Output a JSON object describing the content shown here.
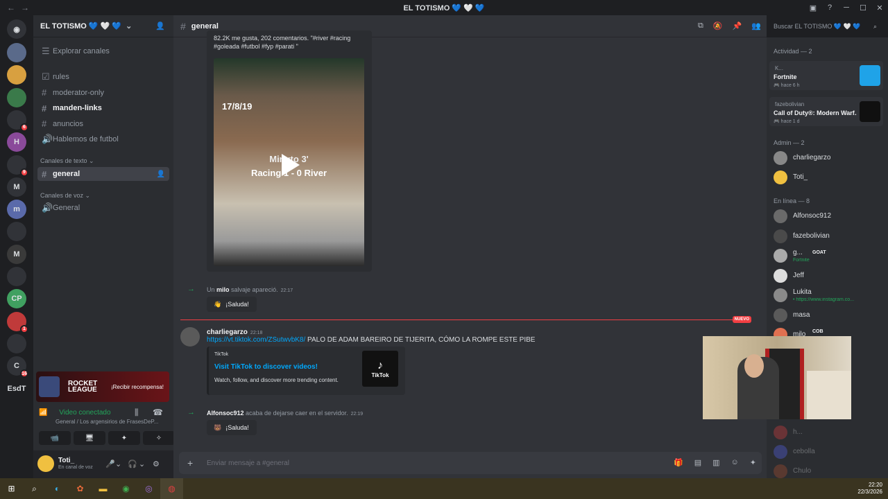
{
  "window": {
    "title": "EL TOTISMO 💙 🤍 💙",
    "nav_back": "←",
    "nav_fwd": "→"
  },
  "servers": {
    "items": [
      {
        "label": "",
        "badge": ""
      },
      {
        "label": "",
        "badge": ""
      },
      {
        "label": "",
        "badge": ""
      },
      {
        "label": "",
        "badge": "6"
      },
      {
        "label": "H",
        "badge": ""
      },
      {
        "label": "",
        "badge": "9"
      },
      {
        "label": "M",
        "badge": ""
      },
      {
        "label": "m",
        "badge": ""
      },
      {
        "label": "",
        "badge": ""
      },
      {
        "label": "M",
        "badge": ""
      },
      {
        "label": "",
        "badge": ""
      },
      {
        "label": "CP",
        "badge": ""
      },
      {
        "label": "",
        "badge": "1"
      },
      {
        "label": "",
        "badge": ""
      },
      {
        "label": "C",
        "badge": "16"
      },
      {
        "label": "EsdT",
        "badge": ""
      }
    ]
  },
  "sidebar": {
    "guild_name": "EL TOTISMO 💙 🤍 💙",
    "browse": "Explorar canales",
    "channels": [
      {
        "name": "rules",
        "state": "normal"
      },
      {
        "name": "moderator-only",
        "state": "normal"
      },
      {
        "name": "manden-links",
        "state": "unread"
      },
      {
        "name": "anuncios",
        "state": "normal"
      },
      {
        "name": "Hablemos de futbol",
        "state": "normal"
      }
    ],
    "text_category": "Canales de texto",
    "active_channel": "general",
    "voice_category": "Canales de voz",
    "voice_channel": "General"
  },
  "promo": {
    "brand": "ROCKET LEAGUE",
    "cta": "¡Recibir recompensa!"
  },
  "voice": {
    "status": "Video conectado",
    "sub": "General / Los argensirios de FrasesDeP...",
    "buttons": [
      "📹",
      "🖥",
      "✦",
      "✧"
    ]
  },
  "user": {
    "name": "Toti_",
    "status": "En canal de voz"
  },
  "chat": {
    "channel": "general",
    "embed_top_text_1": "82.2K me gusta, 202 comentarios. \"#river #racing",
    "embed_top_text_2": "#goleada #futbol #fyp #parati \"",
    "video_overlay_date": "17/8/19",
    "video_overlay_1": "Minuto 3'",
    "video_overlay_2": "Racing 1 - 0 River",
    "sys1": {
      "pre": "Un ",
      "user": "milo",
      "post": " salvaje apareció.",
      "time": "22:17"
    },
    "wave": "¡Saluda!",
    "new_label": "NUEVO",
    "msg": {
      "author": "charliegarzo",
      "time": "22:18",
      "link": "https://vt.tiktok.com/ZSutwvbK8/",
      "text": " PALO DE ADAM BAREIRO DE TIJERITA, CÓMO LA ROMPE ESTE PIBE",
      "embed_provider": "TikTok",
      "embed_title": "Visit TikTok to discover videos!",
      "embed_desc": "Watch, follow, and discover more trending content.",
      "embed_logo": "TikTok"
    },
    "sys2": {
      "user": "Alfonsoc912",
      "post": " acaba de dejarse caer en el servidor.",
      "time": "22:19"
    },
    "placeholder": "Enviar mensaje a #general"
  },
  "members": {
    "search": "Buscar EL TOTISMO 💙 🤍 💙",
    "activity_header": "Actividad — 2",
    "activities": [
      {
        "user": "K...",
        "game": "Fortnite",
        "when": "hace 6 h",
        "color": "#1fa3e8"
      },
      {
        "user": "fazebolivian",
        "game": "Call of Duty®: Modern Warf...",
        "when": "hace 1 d",
        "color": "#101010"
      }
    ],
    "admin_header": "Admin — 2",
    "admins": [
      "charliegarzo",
      "Toti_"
    ],
    "online_header": "En línea — 8",
    "online": [
      {
        "name": "Alfonsoc912",
        "status": ""
      },
      {
        "name": "fazebolivian",
        "status": ""
      },
      {
        "name": "g...",
        "status": "Fortnite",
        "tag": "GOAT"
      },
      {
        "name": "Jeff",
        "status": ""
      },
      {
        "name": "Lukita",
        "status": "• https://www.instagram.co..."
      },
      {
        "name": "masa",
        "status": ""
      },
      {
        "name": "milo",
        "status": "",
        "tag": "COB"
      }
    ],
    "offline": [
      "h...",
      "cebolla",
      "Chulo"
    ]
  },
  "taskbar": {
    "time": "22:20",
    "date": "22/3/2026"
  }
}
